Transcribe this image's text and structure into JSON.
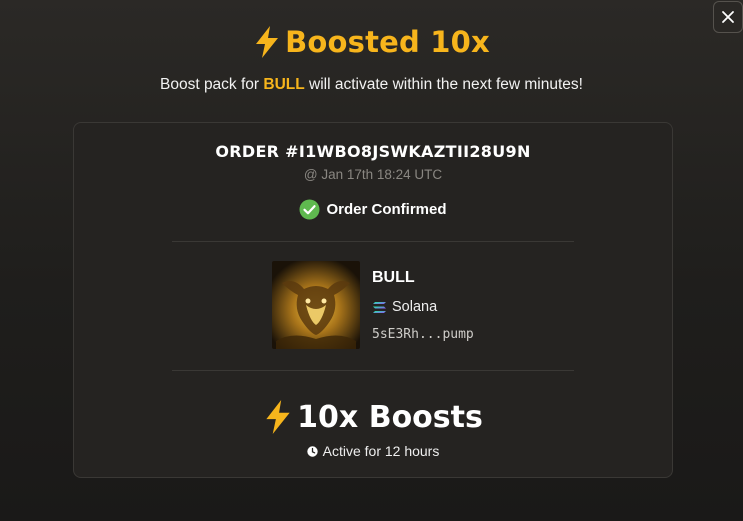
{
  "modal": {
    "close_icon": "close-icon",
    "title_icon": "lightning-bolt-icon",
    "title": "Boosted 10x",
    "subtitle_prefix": "Boost pack for ",
    "subtitle_token": "BULL",
    "subtitle_suffix": " will activate within the next few minutes!"
  },
  "order": {
    "id_label": "ORDER #I1WBO8JSWKAZTII28U9N",
    "timestamp": "@ Jan 17th 18:24 UTC",
    "status_icon": "check-circle-icon",
    "status": "Order Confirmed"
  },
  "token": {
    "image_icon": "bull-token-image",
    "name": "BULL",
    "chain_icon": "solana-icon",
    "chain": "Solana",
    "address": "5sE3Rh...pump"
  },
  "boost": {
    "icon": "lightning-bolt-icon",
    "label": "10x Boosts",
    "duration_icon": "clock-icon",
    "duration": "Active for 12 hours"
  },
  "colors": {
    "accent": "#f7b51c",
    "success": "#5fb94f",
    "background": "#242220",
    "card": "#252321"
  }
}
